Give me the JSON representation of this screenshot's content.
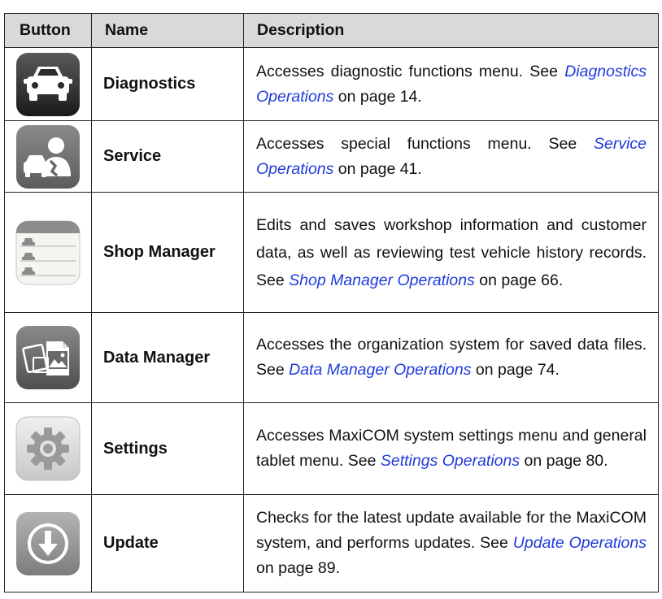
{
  "table": {
    "headers": {
      "button": "Button",
      "name": "Name",
      "description": "Description"
    },
    "rows": [
      {
        "icon": "car-icon",
        "name": "Diagnostics",
        "desc_pre": "Accesses diagnostic functions menu. See ",
        "link": "Diagnostics Operations",
        "desc_post": " on page 14."
      },
      {
        "icon": "service-technician-icon",
        "name": "Service",
        "desc_pre": "Accesses special functions menu. See ",
        "link": "Service Operations",
        "desc_post": " on page 41."
      },
      {
        "icon": "shop-manager-icon",
        "name": "Shop Manager",
        "desc_pre": "Edits and saves workshop information and customer data, as well as reviewing test vehicle history records. See ",
        "link": "Shop Manager Operations",
        "desc_post": " on page 66."
      },
      {
        "icon": "data-manager-icon",
        "name": "Data Manager",
        "desc_pre": "Accesses the organization system for saved data files. See ",
        "link": "Data Manager Operations",
        "desc_post": " on page 74."
      },
      {
        "icon": "settings-gear-icon",
        "name": "Settings",
        "desc_pre": "Accesses MaxiCOM system settings menu and general tablet menu. See ",
        "link": "Settings Operations",
        "desc_post": " on page 80."
      },
      {
        "icon": "update-download-icon",
        "name": "Update",
        "desc_pre": "Checks for the latest update available for the MaxiCOM system, and performs updates. See ",
        "link": "Update Operations",
        "desc_post": " on page 89."
      }
    ]
  }
}
